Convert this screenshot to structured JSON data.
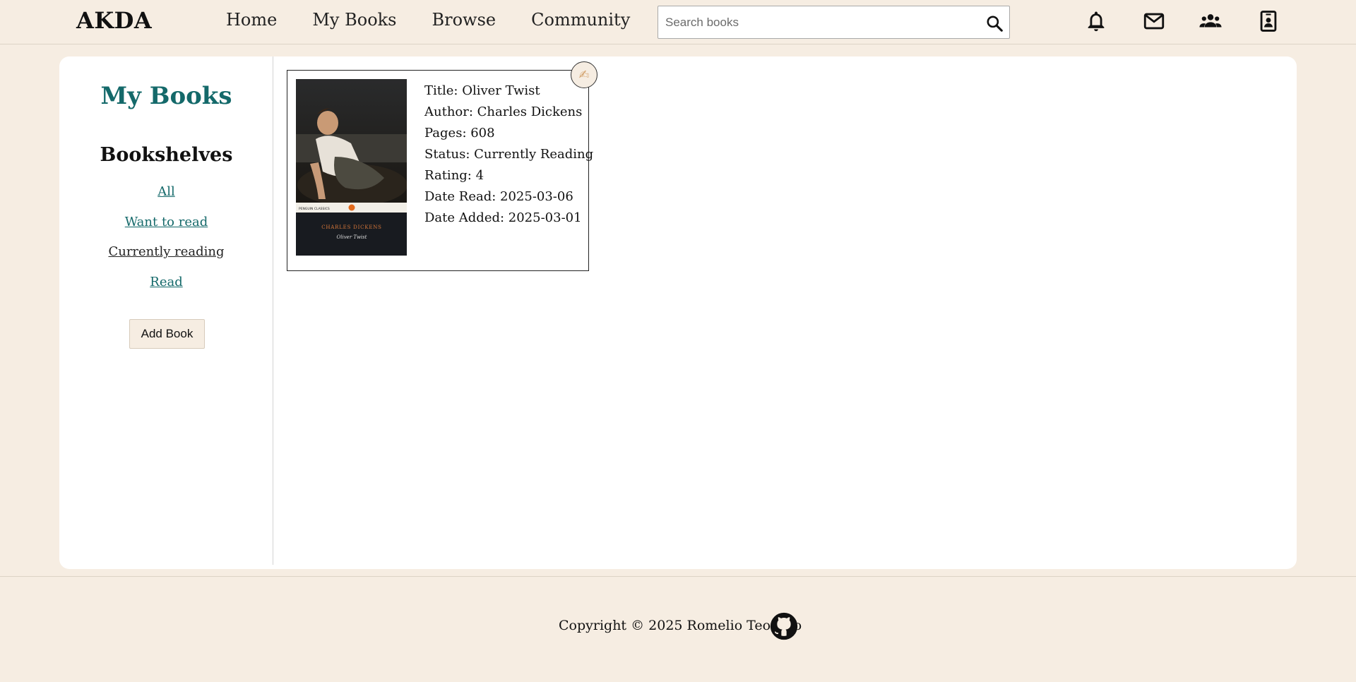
{
  "header": {
    "logo": "AKDA",
    "nav": [
      "Home",
      "My Books",
      "Browse",
      "Community"
    ],
    "search_placeholder": "Search books"
  },
  "sidebar": {
    "title": "My Books",
    "shelves_title": "Bookshelves",
    "shelves": [
      "All",
      "Want to read",
      "Currently reading",
      "Read"
    ],
    "active_shelf": "Currently reading",
    "add_button": "Add Book"
  },
  "book": {
    "title_line": "Title: Oliver Twist",
    "author_line": "Author: Charles Dickens",
    "pages_line": "Pages: 608",
    "status_line": "Status: Currently Reading",
    "rating_line": "Rating: 4",
    "date_read_line": "Date Read: 2025-03-06",
    "date_added_line": "Date Added: 2025-03-01",
    "cover": {
      "series": "PENGUIN  CLASSICS",
      "author": "CHARLES DICKENS",
      "title": "Oliver Twist"
    },
    "edit_icon": "✍"
  },
  "footer": {
    "copyright": "Copyright © 2025 Romelio Teodoro"
  },
  "colors": {
    "background": "#f6ede2",
    "accent": "#14696a"
  }
}
